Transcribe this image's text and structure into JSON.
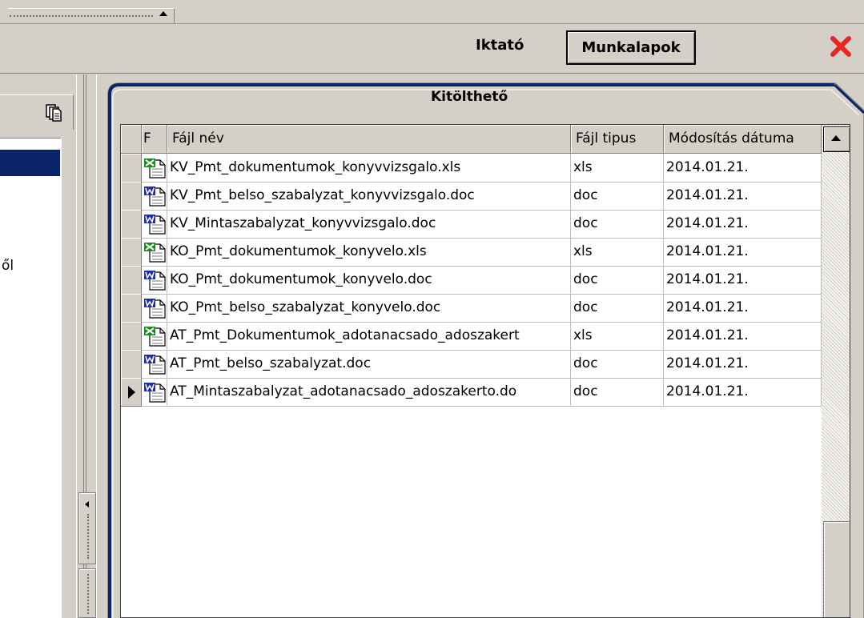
{
  "header": {
    "tab_iktato": "Iktató",
    "tab_munkalapok": "Munkalapok"
  },
  "left_panel": {
    "text_fragment": "ől"
  },
  "panel": {
    "title": "Kitölthető"
  },
  "grid": {
    "columns": {
      "flag": "F",
      "name": "Fájl név",
      "type": "Fájl tipus",
      "date": "Módosítás dátuma"
    },
    "rows": [
      {
        "icon": "excel-file-icon",
        "name": "KV_Pmt_dokumentumok_konyvvizsgalo.xls",
        "type": "xls",
        "date": "2014.01.21."
      },
      {
        "icon": "word-file-icon",
        "name": "KV_Pmt_belso_szabalyzat_konyvvizsgalo.doc",
        "type": "doc",
        "date": "2014.01.21."
      },
      {
        "icon": "word-file-icon",
        "name": "KV_Mintaszabalyzat_konyvvizsgalo.doc",
        "type": "doc",
        "date": "2014.01.21."
      },
      {
        "icon": "excel-file-icon",
        "name": "KO_Pmt_dokumentumok_konyvelo.xls",
        "type": "xls",
        "date": "2014.01.21."
      },
      {
        "icon": "word-file-icon",
        "name": "KO_Pmt_dokumentumok_konyvelo.doc",
        "type": "doc",
        "date": "2014.01.21."
      },
      {
        "icon": "word-file-icon",
        "name": "KO_Pmt_belso_szabalyzat_konyvelo.doc",
        "type": "doc",
        "date": "2014.01.21."
      },
      {
        "icon": "excel-file-icon",
        "name": "AT_Pmt_Dokumentumok_adotanacsado_adoszakert",
        "type": "xls",
        "date": "2014.01.21."
      },
      {
        "icon": "word-file-icon",
        "name": "AT_Pmt_belso_szabalyzat.doc",
        "type": "doc",
        "date": "2014.01.21."
      },
      {
        "icon": "word-file-icon",
        "name": "AT_Mintaszabalyzat_adotanacsado_adoszakerto.do",
        "type": "doc",
        "date": "2014.01.21.",
        "selected": true
      }
    ]
  },
  "colors": {
    "face": "#d4d0c8",
    "selection": "#0a246a",
    "close": "#e8281e",
    "tab_accent": "#0a246a"
  }
}
